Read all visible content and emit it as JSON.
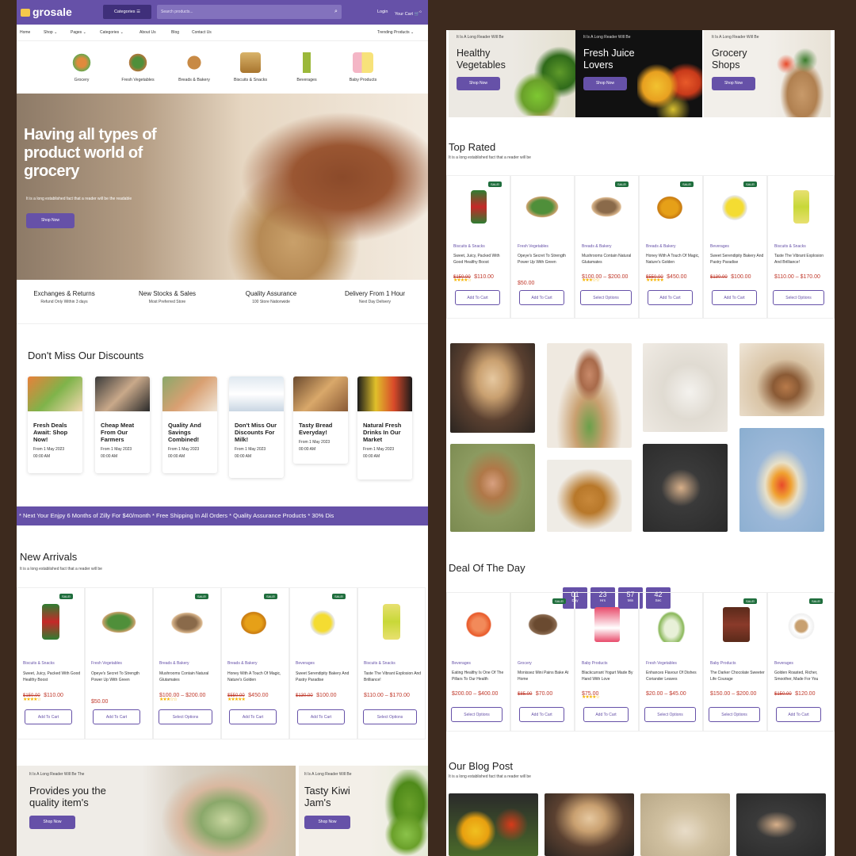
{
  "header": {
    "logo": "grosale",
    "categories_btn": "Categories",
    "search_placeholder": "Search products...",
    "login": "Login",
    "cart": "Your Cart",
    "cart_count": "0"
  },
  "nav": {
    "items": [
      "Home",
      "Shop",
      "Pages",
      "Categories",
      "About Us",
      "Blog",
      "Contact Us"
    ],
    "trending": "Trending Products"
  },
  "categories": [
    "Grocery",
    "Fresh Vegetables",
    "Breads & Bakery",
    "Biscuits & Snacks",
    "Beverages",
    "Baby Products"
  ],
  "hero": {
    "title": "Having all types of product world of grocery",
    "subtitle": "It is a long established fact that a reader will be the readable",
    "button": "Shop Now"
  },
  "features": [
    {
      "title": "Exchanges & Returns",
      "sub": "Refund Only Within 3 days"
    },
    {
      "title": "New Stocks & Sales",
      "sub": "Most Preferred Store"
    },
    {
      "title": "Quality Assurance",
      "sub": "100 Store Nationwide"
    },
    {
      "title": "Delivery From 1 Hour",
      "sub": "Next Day Delivery"
    }
  ],
  "discounts": {
    "title": "Don't Miss Our Discounts",
    "cards": [
      {
        "title": "Fresh Deals Await: Shop Now!",
        "date": "From 1 May 2023",
        "time": "00:00 AM"
      },
      {
        "title": "Cheap Meat From Our Farmers",
        "date": "From 1 May 2023",
        "time": "00:00 AM"
      },
      {
        "title": "Quality And Savings Combined!",
        "date": "From 1 May 2023",
        "time": "00:00 AM"
      },
      {
        "title": "Don't Miss Our Discounts For Milk!",
        "date": "From 1 May 2023",
        "time": "00:00 AM"
      },
      {
        "title": "Tasty Bread Everyday!",
        "date": "From 1 May 2023",
        "time": "00:00 AM"
      },
      {
        "title": "Natural Fresh Drinks In Our Market",
        "date": "From 1 May 2023",
        "time": "00:00 AM"
      }
    ]
  },
  "ticker": "* Next Your Enjpy 6 Months of Zilly For $40/month    * Free Shipping In All Orders    * Quality Assurance Products    * 30% Dis",
  "new_arrivals": {
    "title": "New Arrivals",
    "subtitle": "It is a long established fact that a reader will be"
  },
  "products": [
    {
      "cat": "Biscuits & Snacks",
      "name": "Sweet, Juicy, Packed With Good Healthy Boost",
      "old": "$150.00",
      "price": "$110.00",
      "stars": "★★★★☆",
      "btn": "Add To Cart",
      "sale": "SALE!"
    },
    {
      "cat": "Fresh Vegetables",
      "name": "Opeye's Secret To Strength Power Up With Green",
      "old": "",
      "price": "$50.00",
      "stars": "",
      "btn": "Add To Cart",
      "sale": ""
    },
    {
      "cat": "Breads & Bakery",
      "name": "Mushrooms Contain Natural Glutamates",
      "old": "",
      "price": "$100.00 – $200.00",
      "stars": "★★★☆☆",
      "btn": "Select Options",
      "sale": "SALE!"
    },
    {
      "cat": "Breads & Bakery",
      "name": "Honey With A Touch Of Magic, Nature's Golden",
      "old": "$550.00",
      "price": "$450.00",
      "stars": "★★★★★",
      "btn": "Add To Cart",
      "sale": "SALE!"
    },
    {
      "cat": "Beverages",
      "name": "Sweet Serendipity Bakery And Pastry Paradise",
      "old": "$130.00",
      "price": "$100.00",
      "stars": "",
      "btn": "Add To Cart",
      "sale": "SALE!"
    },
    {
      "cat": "Biscuits & Snacks",
      "name": "Taste The Vibrant Explosion And Brilliance!",
      "old": "",
      "price": "$110.00 – $170.00",
      "stars": "",
      "btn": "Select Options",
      "sale": ""
    }
  ],
  "banners_left": [
    {
      "kicker": "It Is A Long Reader Will Be The",
      "title": "Provides you the quality item's",
      "button": "Shop Now"
    },
    {
      "kicker": "It Is A Long Reader Will Be",
      "title": "Tasty Kiwi Jam's",
      "button": "Shop Now"
    }
  ],
  "banners_right": [
    {
      "kicker": "It Is A Long Reader Will Be",
      "title": "Healthy Vegetables",
      "button": "Shop Now"
    },
    {
      "kicker": "It Is A Long Reader Will Be",
      "title": "Fresh Juice Lovers",
      "button": "Shop Now"
    },
    {
      "kicker": "It Is A Long Reader Will Be",
      "title": "Grocery Shops",
      "button": "Shop Now"
    }
  ],
  "top_rated": {
    "title": "Top Rated",
    "subtitle": "It is a long established fact that a reader will be"
  },
  "deal": {
    "title": "Deal Of The Day",
    "timer": [
      {
        "n": "01",
        "u": "Day"
      },
      {
        "n": "23",
        "u": "Hrs"
      },
      {
        "n": "57",
        "u": "Min"
      },
      {
        "n": "42",
        "u": "Sec"
      }
    ]
  },
  "deal_products": [
    {
      "cat": "Beverages",
      "name": "Eating Healthy Is One Of The Pillars To Our Health",
      "old": "",
      "price": "$200.00 – $400.00",
      "btn": "Select Options",
      "sale": ""
    },
    {
      "cat": "Grocery",
      "name": "Monissez Mini Pains Bake At Home",
      "old": "$85.00",
      "price": "$70.00",
      "btn": "Add To Cart",
      "sale": "SALE!"
    },
    {
      "cat": "Baby Products",
      "name": "Blackcurrant Yogurt Made By Hand With Love",
      "old": "",
      "price": "$75.00",
      "stars": "★★★★☆",
      "btn": "Add To Cart",
      "sale": ""
    },
    {
      "cat": "Fresh Vegetables",
      "name": "Enhances Flavour Of Dishes Coriander Leaves",
      "old": "",
      "price": "$20.00 – $45.00",
      "btn": "Select Options",
      "sale": ""
    },
    {
      "cat": "Baby Products",
      "name": "The Darker Chocolate Sweeter Life Courage",
      "old": "",
      "price": "$150.00 – $200.00",
      "btn": "Select Options",
      "sale": "SALE!"
    },
    {
      "cat": "Beverages",
      "name": "Golden Roasted, Richer, Smoother, Made For You",
      "old": "$150.00",
      "price": "$120.00",
      "btn": "Add To Cart",
      "sale": "SALE!"
    }
  ],
  "blog": {
    "title": "Our Blog Post",
    "subtitle": "It is a long established fact that a reader will be"
  }
}
